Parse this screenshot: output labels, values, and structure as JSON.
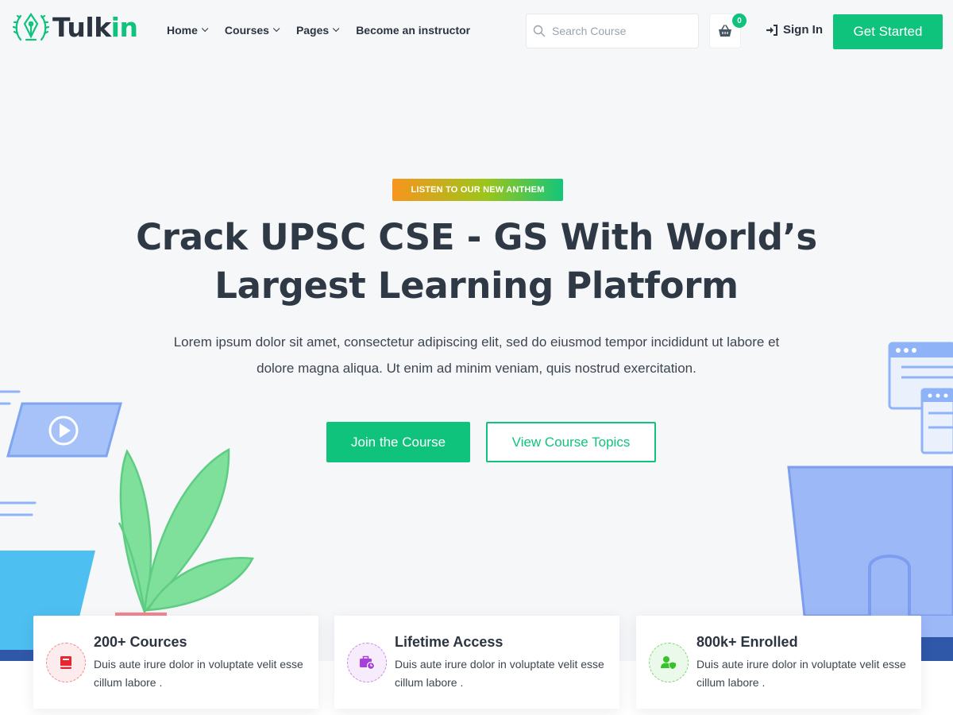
{
  "header": {
    "logo_part1": "Tulk",
    "logo_part2": "in",
    "nav": [
      {
        "label": "Home",
        "dropdown": true
      },
      {
        "label": "Courses",
        "dropdown": true
      },
      {
        "label": "Pages",
        "dropdown": true
      },
      {
        "label": "Become an instructor",
        "dropdown": false
      }
    ],
    "search_placeholder": "Search Course",
    "cart_count": "0",
    "signin_label": "Sign In",
    "cta_label": "Get Started"
  },
  "hero": {
    "badge": "LISTEN TO OUR NEW ANTHEM",
    "title_line1": "Crack UPSC CSE - GS With World’s",
    "title_line2": "Largest Learning Platform",
    "desc_line1": "Lorem ipsum dolor sit amet, consectetur adipiscing elit, sed do eiusmod tempor incididunt ut labore et",
    "desc_line2": "dolore magna aliqua. Ut enim ad minim veniam, quis nostrud exercitation.",
    "primary_button": "Join the Course",
    "secondary_button": "View Course Topics"
  },
  "features": [
    {
      "icon": "book-icon",
      "title": "200+ Cources",
      "desc": "Duis aute irure dolor in voluptate velit esse cillum labore .",
      "color": "#e8262f"
    },
    {
      "icon": "briefcase-clock-icon",
      "title": "Lifetime Access",
      "desc": "Duis aute irure dolor in voluptate velit esse cillum labore .",
      "color": "#a640d9"
    },
    {
      "icon": "user-shield-icon",
      "title": "800k+ Enrolled",
      "desc": "Duis aute irure dolor in voluptate velit esse cillum labore .",
      "color": "#35c22a"
    }
  ],
  "colors": {
    "accent": "#10c37c",
    "text": "#2b3440",
    "background": "#f6f7f9"
  }
}
